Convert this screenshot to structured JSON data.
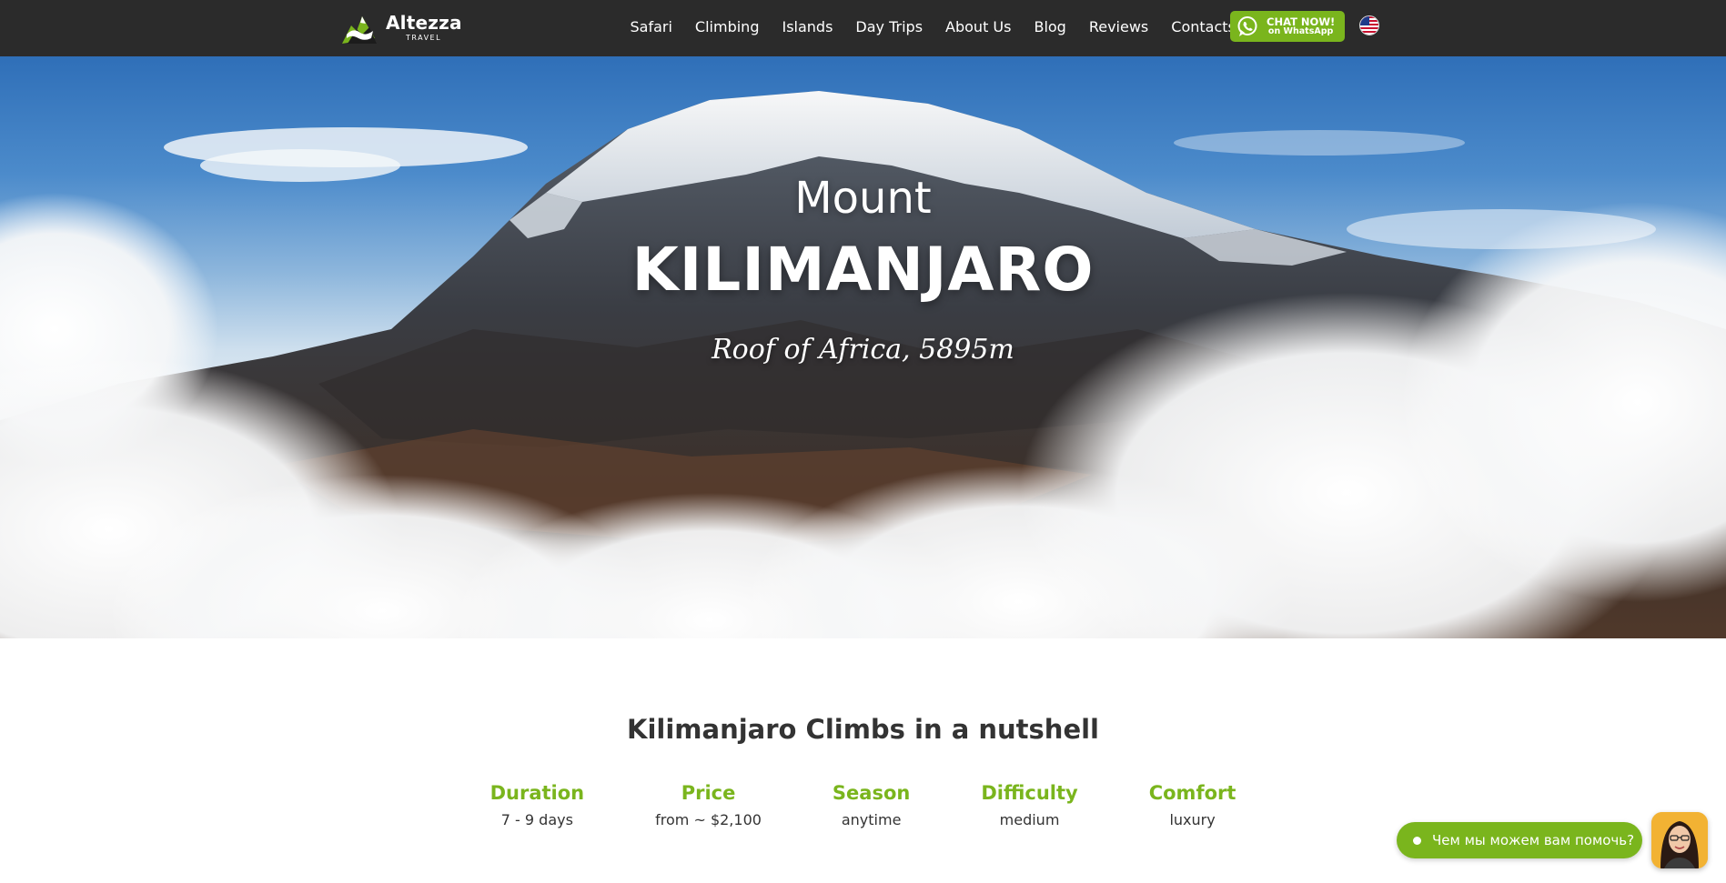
{
  "header": {
    "logo": {
      "name": "Altezza",
      "sub": "TRAVEL"
    },
    "nav": [
      "Safari",
      "Climbing",
      "Islands",
      "Day Trips",
      "About Us",
      "Blog",
      "Reviews",
      "Contacts"
    ],
    "whatsapp": {
      "line1": "CHAT NOW!",
      "line2": "on WhatsApp",
      "color": "#7ab51d"
    },
    "language_flag": "us-flag-icon"
  },
  "hero": {
    "pre_title": "Mount",
    "title": "KILIMANJARO",
    "tagline": "Roof of Africa, 5895m"
  },
  "nutshell": {
    "title": "Kilimanjaro Climbs in a nutshell",
    "facts": [
      {
        "label": "Duration",
        "value": "7 - 9 days"
      },
      {
        "label": "Price",
        "value": "from ~ $2,100"
      },
      {
        "label": "Season",
        "value": "anytime"
      },
      {
        "label": "Difficulty",
        "value": "medium"
      },
      {
        "label": "Comfort",
        "value": "luxury"
      }
    ]
  },
  "chat_widget": {
    "text": "Чем мы можем вам помочь?",
    "avatar": "support-agent-avatar"
  },
  "colors": {
    "accent": "#7ab51d",
    "header_bg": "#2b2b2b",
    "heading_text": "#333333"
  }
}
